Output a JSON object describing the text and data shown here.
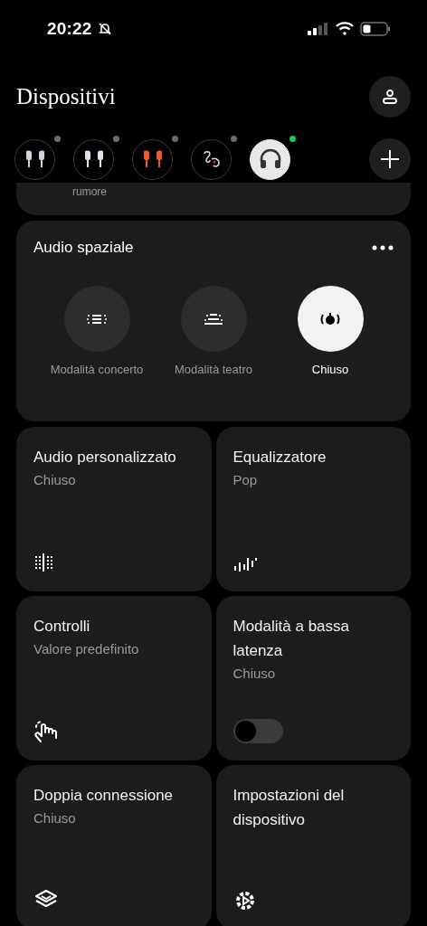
{
  "status_bar": {
    "time": "20:22",
    "silent": true
  },
  "header": {
    "title": "Dispositivi"
  },
  "devices": [
    {
      "selected": false,
      "color": "#6b6b6b"
    },
    {
      "selected": false,
      "color": "#6b6b6b"
    },
    {
      "selected": false,
      "color": "#6b6b6b"
    },
    {
      "selected": false,
      "color": "#6b6b6b"
    },
    {
      "selected": true,
      "color": "#22c55e"
    }
  ],
  "partial_card": {
    "text": "rumore"
  },
  "spatial_audio": {
    "title": "Audio spaziale",
    "modes": [
      {
        "label": "Modalità concerto",
        "selected": false
      },
      {
        "label": "Modalità teatro",
        "selected": false
      },
      {
        "label": "Chiuso",
        "selected": true
      }
    ]
  },
  "tiles": [
    {
      "kind": "icon",
      "title": "Audio personalizzato",
      "value": "Chiuso"
    },
    {
      "kind": "icon",
      "title": "Equalizzatore",
      "value": "Pop"
    },
    {
      "kind": "icon",
      "title": "Controlli",
      "value": "Valore predefinito"
    },
    {
      "kind": "toggle",
      "title": "Modalità a bassa latenza",
      "value": "Chiuso",
      "on": false
    },
    {
      "kind": "icon",
      "title": "Doppia connessione",
      "value": "Chiuso"
    },
    {
      "kind": "icon",
      "title": "Impostazioni del dispositivo"
    }
  ]
}
